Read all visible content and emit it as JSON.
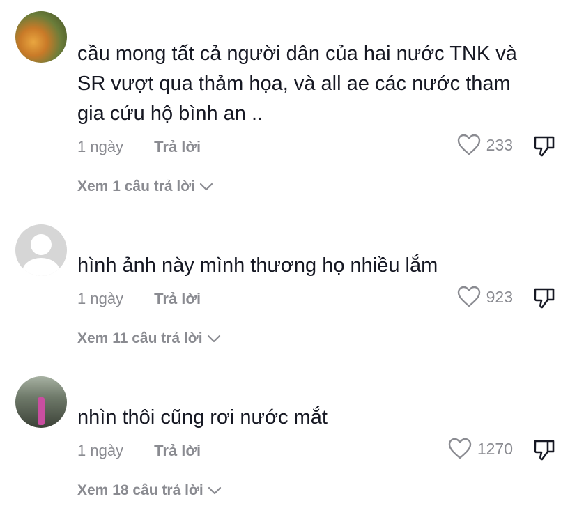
{
  "comments": [
    {
      "text": "cầu mong tất cả người dân của hai nước TNK và\nSR vượt qua thảm họa, và all ae các nước tham\ngia cứu hộ bình an ..",
      "time": "1 ngày",
      "reply_label": "Trả lời",
      "likes": "233",
      "view_replies": "Xem 1 câu trả lời"
    },
    {
      "text": "hình ảnh này mình thương họ nhiều lắm",
      "time": "1 ngày",
      "reply_label": "Trả lời",
      "likes": "923",
      "view_replies": "Xem 11 câu trả lời"
    },
    {
      "text": "nhìn thôi cũng rơi nước mắt",
      "time": "1 ngày",
      "reply_label": "Trả lời",
      "likes": "1270",
      "view_replies": "Xem 18 câu trả lời"
    }
  ],
  "icons": {
    "like": "heart-outline-icon",
    "dislike": "thumbs-down-icon",
    "expand": "chevron-down-icon"
  },
  "colors": {
    "text": "#161823",
    "meta": "#8a8b91",
    "background": "#ffffff"
  }
}
